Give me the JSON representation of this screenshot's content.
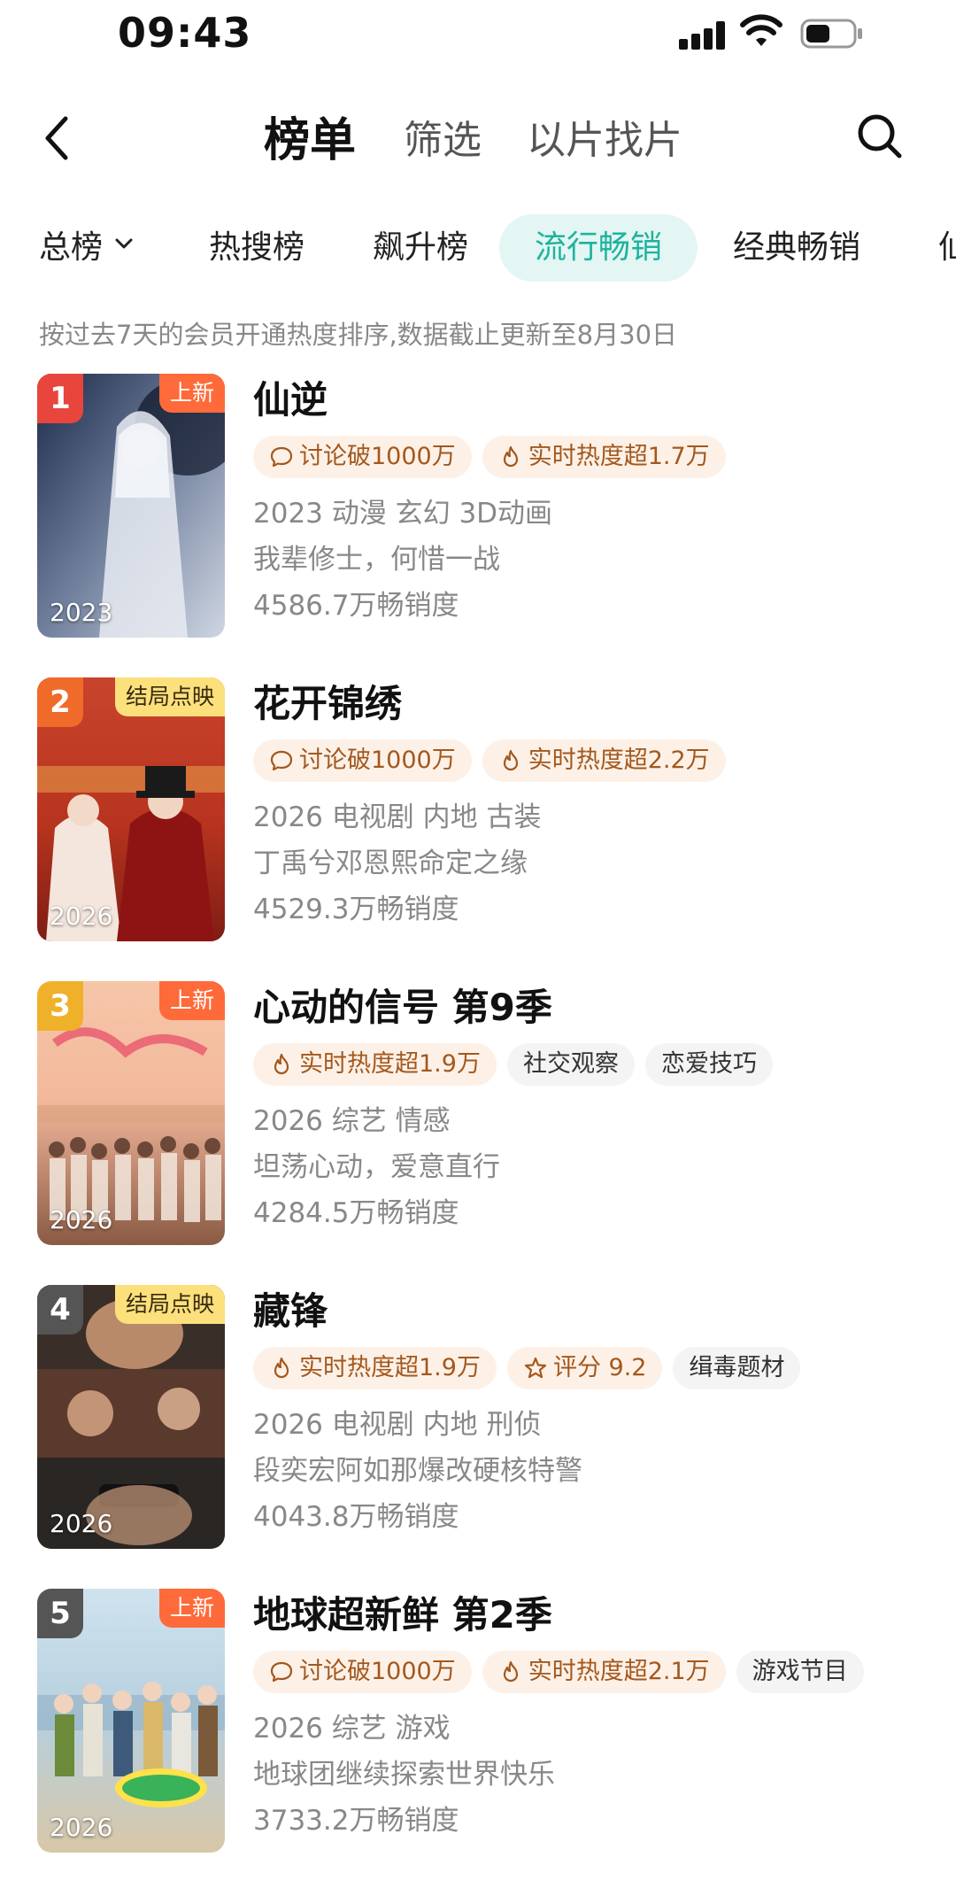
{
  "status_bar": {
    "time": "09:43"
  },
  "header": {
    "tabs": [
      {
        "label": "榜单",
        "active": true
      },
      {
        "label": "筛选",
        "active": false
      },
      {
        "label": "以片找片",
        "active": false
      }
    ]
  },
  "categories": [
    {
      "label": "总榜",
      "active": false,
      "has_dropdown": true
    },
    {
      "label": "热搜榜",
      "active": false
    },
    {
      "label": "飙升榜",
      "active": false
    },
    {
      "label": "流行畅销",
      "active": true
    },
    {
      "label": "经典畅销",
      "active": false
    }
  ],
  "colors": {
    "accent": "#1fb39f",
    "accent_bg": "#e3f6f3",
    "new_badge": "#ff6a3a",
    "finale_badge": "#fbe07c",
    "hot_tag_bg": "#fdf1e7"
  },
  "subtitle": "按过去7天的会员开通热度排序,数据截止更新至8月30日",
  "items": [
    {
      "rank": "1",
      "rank_color": "#e8453c",
      "badge": "上新",
      "badge_type": "new",
      "year": "2023",
      "title": "仙逆",
      "tags": [
        {
          "icon": "chat-bubble-icon",
          "text": "讨论破1000万",
          "style": "hot"
        },
        {
          "icon": "flame-icon",
          "text": "实时热度超1.7万",
          "style": "hot"
        }
      ],
      "meta": "2023 动漫 玄幻 3D动画",
      "desc": "我辈修士，何惜一战",
      "sales": "4586.7万畅销度"
    },
    {
      "rank": "2",
      "rank_color": "#f06a2a",
      "badge": "结局点映",
      "badge_type": "finale",
      "year": "2026",
      "title": "花开锦绣",
      "tags": [
        {
          "icon": "chat-bubble-icon",
          "text": "讨论破1000万",
          "style": "hot"
        },
        {
          "icon": "flame-icon",
          "text": "实时热度超2.2万",
          "style": "hot"
        }
      ],
      "meta": "2026 电视剧 内地 古装",
      "desc": "丁禹兮邓恩熙命定之缘",
      "sales": "4529.3万畅销度"
    },
    {
      "rank": "3",
      "rank_color": "#f0b12a",
      "badge": "上新",
      "badge_type": "new",
      "year": "2026",
      "title": "心动的信号 第9季",
      "tags": [
        {
          "icon": "flame-icon",
          "text": "实时热度超1.9万",
          "style": "hot"
        },
        {
          "icon": "",
          "text": "社交观察",
          "style": "plain"
        },
        {
          "icon": "",
          "text": "恋爱技巧",
          "style": "plain"
        }
      ],
      "meta": "2026 综艺 情感",
      "desc": "坦荡心动，爱意直行",
      "sales": "4284.5万畅销度"
    },
    {
      "rank": "4",
      "rank_color": "#666666",
      "badge": "结局点映",
      "badge_type": "finale",
      "year": "2026",
      "title": "藏锋",
      "tags": [
        {
          "icon": "flame-icon",
          "text": "实时热度超1.9万",
          "style": "hot"
        },
        {
          "icon": "star-icon",
          "text": "评分 9.2",
          "style": "hot"
        },
        {
          "icon": "",
          "text": "缉毒题材",
          "style": "plain"
        }
      ],
      "meta": "2026 电视剧 内地 刑侦",
      "desc": "段奕宏阿如那爆改硬核特警",
      "sales": "4043.8万畅销度"
    },
    {
      "rank": "5",
      "rank_color": "#666666",
      "badge": "上新",
      "badge_type": "new",
      "year": "2026",
      "title": "地球超新鲜 第2季",
      "tags": [
        {
          "icon": "chat-bubble-icon",
          "text": "讨论破1000万",
          "style": "hot"
        },
        {
          "icon": "flame-icon",
          "text": "实时热度超2.1万",
          "style": "hot"
        },
        {
          "icon": "",
          "text": "游戏节目",
          "style": "plain"
        }
      ],
      "meta": "2026 综艺 游戏",
      "desc": "地球团继续探索世界快乐",
      "sales": "3733.2万畅销度"
    }
  ]
}
